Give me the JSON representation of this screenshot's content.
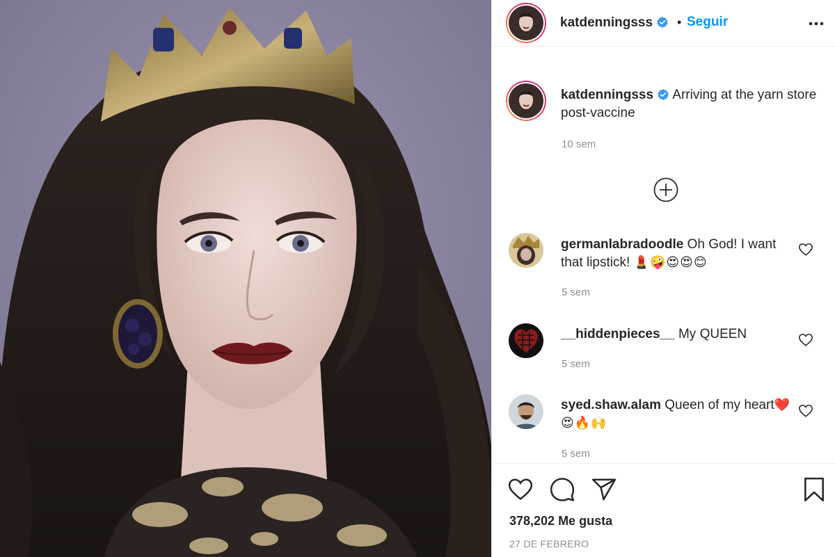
{
  "post": {
    "image_alt": "Portrait photo of a woman with long dark wavy hair wearing a jeweled crown and ornate earrings against a lavender background"
  },
  "header": {
    "username": "katdenningsss",
    "dot": "•",
    "follow_label": "Seguir",
    "verified_icon": "verified-badge-icon",
    "more_icon": "more-options-icon"
  },
  "caption": {
    "username": "katdenningsss",
    "text": "Arriving at the yarn store post-vaccine",
    "time": "10 sem"
  },
  "load_more_icon": "plus-circle-icon",
  "comments": [
    {
      "username": "germanlabradoodle",
      "text": "Oh God! I want that lipstick!",
      "emojis": "💄🤪😍😍😊",
      "time": "5 sem"
    },
    {
      "username": "__hiddenpieces__",
      "text": "My QUEEN",
      "emojis": "",
      "time": "5 sem"
    },
    {
      "username": "syed.shaw.alam",
      "text": "Queen of my heart",
      "emojis": "❤️😍🔥🙌",
      "time": "5 sem"
    }
  ],
  "actions": {
    "like_icon": "heart-icon",
    "comment_icon": "comment-icon",
    "share_icon": "share-icon",
    "save_icon": "bookmark-icon"
  },
  "likes": "378,202 Me gusta",
  "date": "27 DE FEBRERO",
  "colors": {
    "follow": "#0095f6",
    "verified": "#3897f0",
    "muted": "#8e8e8e",
    "text": "#262626",
    "photo_background": "#8c86a1"
  }
}
